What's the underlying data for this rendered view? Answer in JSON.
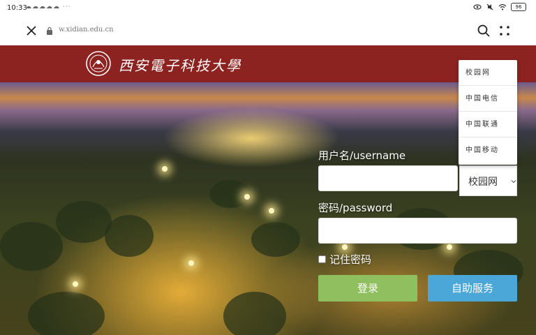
{
  "status_bar": {
    "time": "10:33",
    "notifications": "☁☁☁☁☁ ···",
    "battery": "96"
  },
  "address_bar": {
    "url": "w.xidian.edu.cn"
  },
  "header": {
    "university_name": "西安電子科技大學"
  },
  "login_form": {
    "username_label": "用户名/username",
    "username_value": "",
    "password_label": "密码/password",
    "password_value": "",
    "remember_label": "记住密码",
    "login_button": "登录",
    "self_service_button": "自助服务",
    "network_select_value": "校园网"
  },
  "network_dropdown": {
    "options": [
      "校园网",
      "中国电信",
      "中国联通",
      "中国移动"
    ]
  }
}
